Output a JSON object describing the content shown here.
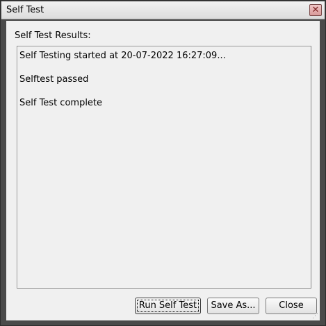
{
  "window": {
    "title": "Self Test",
    "close_icon": "close-icon"
  },
  "main": {
    "results_label": "Self Test Results:",
    "results_lines": [
      "Self Testing started at 20-07-2022 16:27:09...",
      "Selftest passed",
      "Self Test complete"
    ]
  },
  "buttons": {
    "run_self_test": "Run Self Test",
    "save_as": "Save As...",
    "close": "Close"
  },
  "colors": {
    "window_frame": "#4a4a4a",
    "client_background": "#f0f0f0",
    "close_button": "#d89a9a"
  }
}
